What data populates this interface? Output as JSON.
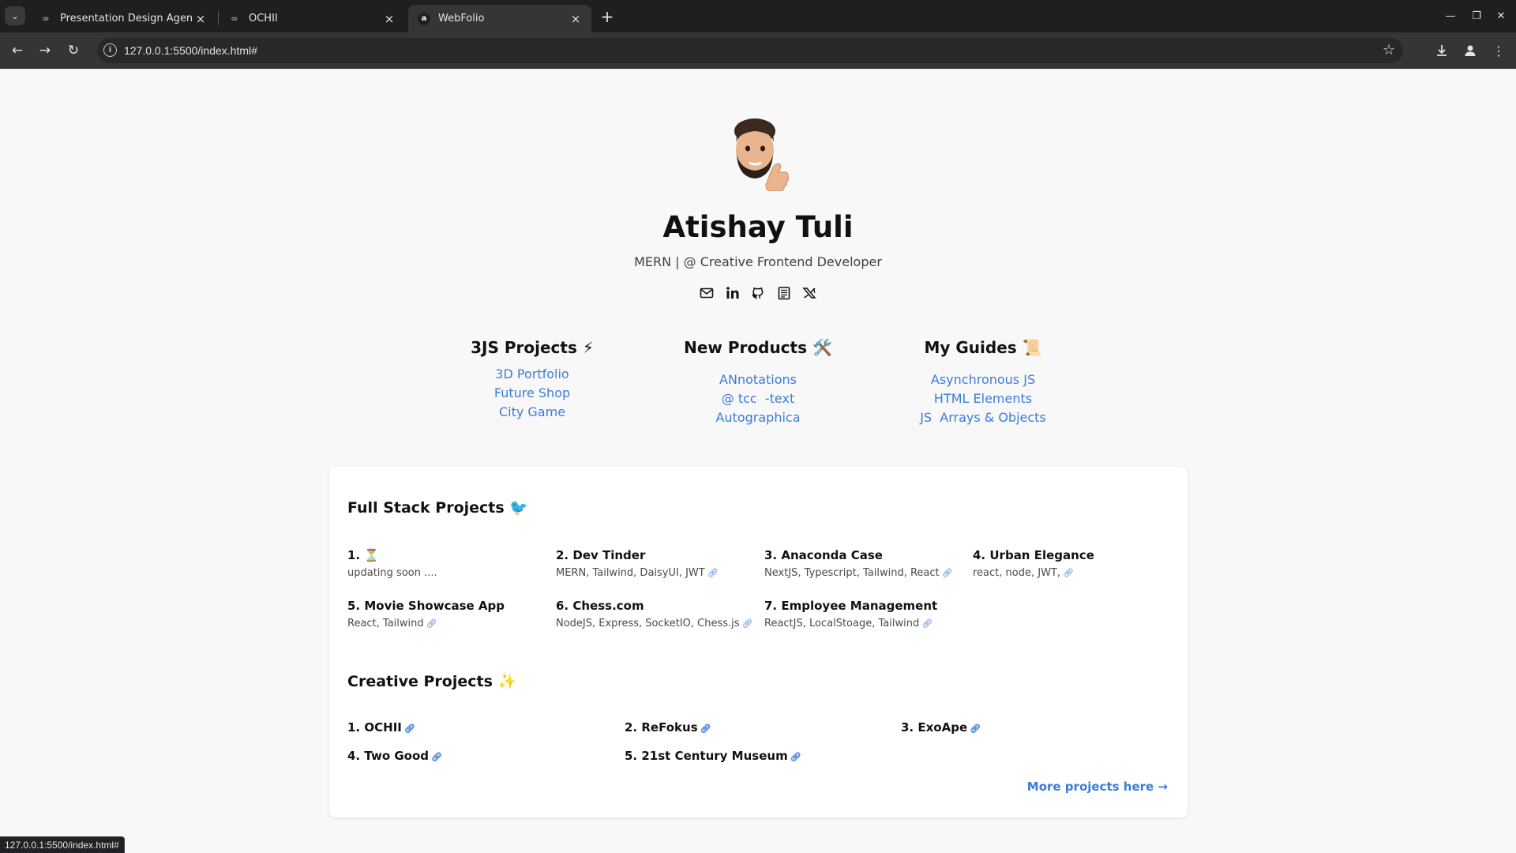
{
  "browser": {
    "tabs": [
      {
        "title": "Presentation Design Agency"
      },
      {
        "title": "OCHII"
      },
      {
        "title": "WebFolio"
      }
    ],
    "url": "127.0.0.1:5500/index.html#",
    "status_url": "127.0.0.1:5500/index.html#"
  },
  "profile": {
    "name": "Atishay Tuli",
    "subtitle": "MERN | @ Creative Frontend Developer",
    "social_icons": [
      "mail-icon",
      "linkedin-icon",
      "github-icon",
      "resume-icon",
      "twitter-x-icon"
    ]
  },
  "columns": [
    {
      "heading": "3JS Projects ⚡",
      "links": [
        "3D Portfolio",
        "Future Shop",
        "City Game"
      ]
    },
    {
      "heading": "New Products 🛠️",
      "links": [
        "ANnotations",
        "@ tcc  -text",
        "Autographica"
      ]
    },
    {
      "heading": "My Guides 📜",
      "links": [
        "Asynchronous JS",
        "HTML Elements",
        "JS  Arrays & Objects"
      ]
    }
  ],
  "full_stack": {
    "heading": "Full Stack Projects 🐦",
    "items": [
      {
        "num": "1.",
        "title": "⏳",
        "desc": "updating soon ....",
        "link": false
      },
      {
        "num": "2.",
        "title": "Dev Tinder",
        "desc": "MERN, Tailwind, DaisyUI, JWT",
        "link": true
      },
      {
        "num": "3.",
        "title": "Anaconda Case",
        "desc": "NextJS, Typescript, Tailwind, React",
        "link": true
      },
      {
        "num": "4.",
        "title": "Urban Elegance",
        "desc": "react, node, JWT,",
        "link": true
      },
      {
        "num": "5.",
        "title": "Movie Showcase App",
        "desc": "React, Tailwind",
        "link": true
      },
      {
        "num": "6.",
        "title": "Chess.com",
        "desc": "NodeJS, Express, SocketIO, Chess.js",
        "link": true
      },
      {
        "num": "7.",
        "title": "Employee Management",
        "desc": "ReactJS, LocalStoage, Tailwind",
        "link": true
      }
    ]
  },
  "creative": {
    "heading": "Creative Projects ✨",
    "items": [
      {
        "num": "1.",
        "title": "OCHII"
      },
      {
        "num": "2.",
        "title": "ReFokus"
      },
      {
        "num": "3.",
        "title": "ExoApe"
      },
      {
        "num": "4.",
        "title": "Two Good"
      },
      {
        "num": "5.",
        "title": "21st Century Museum"
      }
    ]
  },
  "more_link": "More projects here →",
  "colors": {
    "link": "#3b7cd9",
    "text": "#111111",
    "page_bg": "#f8f8f8",
    "chrome_bg": "#1f1f1f"
  }
}
